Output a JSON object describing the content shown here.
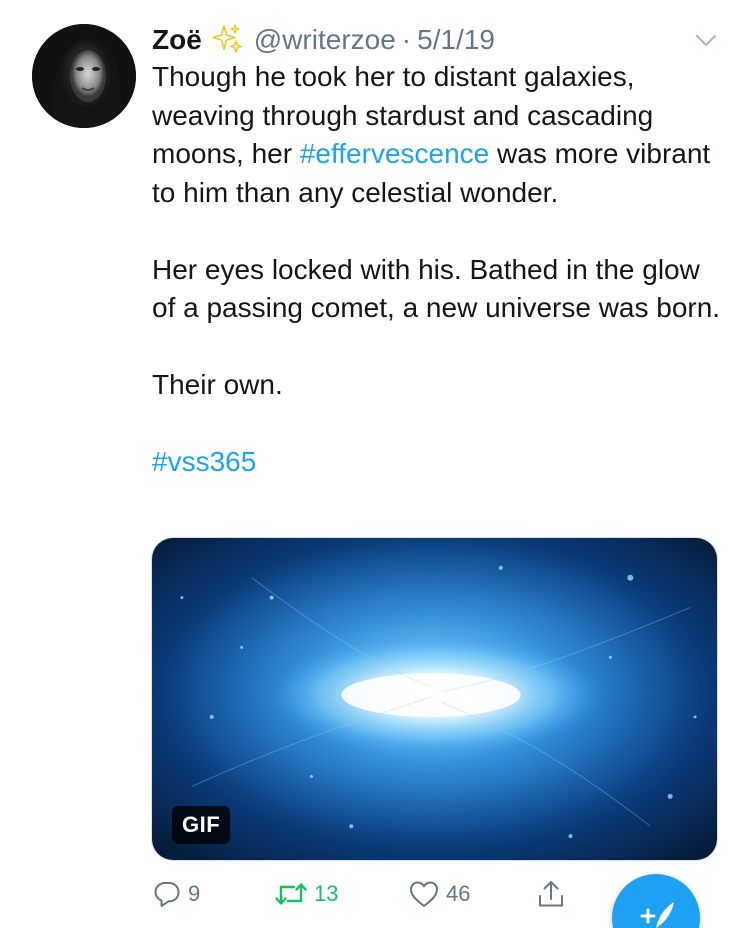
{
  "tweet": {
    "author_name": "Zoë",
    "author_handle": "@writerzoe",
    "separator": "·",
    "date": "5/1/19",
    "paragraph1_before": "Though he took her to distant galaxies, weaving through stardust and cascading moons, her ",
    "paragraph1_hashtag": "#effervescence",
    "paragraph1_after": " was more vibrant to him than any celestial wonder.",
    "paragraph2": "Her eyes locked with his. Bathed in the glow of a passing comet, a new universe was born.",
    "paragraph3": "Their own.",
    "hashtag": "#vss365",
    "media_badge": "GIF"
  },
  "actions": {
    "reply_count": "9",
    "retweet_count": "13",
    "like_count": "46"
  },
  "colors": {
    "link": "#1da1f2",
    "retweet": "#17bf63",
    "secondary_text": "#657786"
  },
  "icons": {
    "sparkle": "sparkles-icon",
    "chevron": "chevron-down-icon",
    "reply": "reply-icon",
    "retweet": "retweet-icon",
    "like": "heart-icon",
    "share": "share-icon",
    "compose": "compose-tweet-icon"
  }
}
